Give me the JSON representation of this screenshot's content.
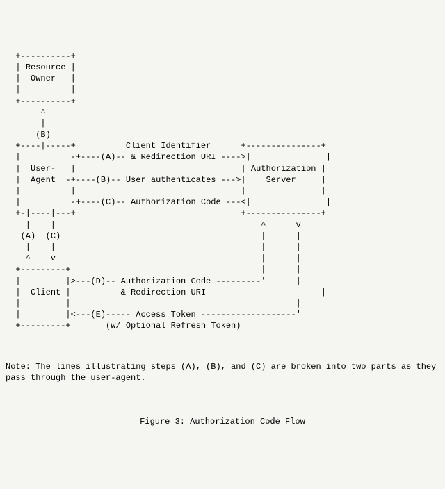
{
  "boxes": {
    "resource_owner_l1": "Resource",
    "resource_owner_l2": "Owner",
    "user_agent_l1": "User-",
    "user_agent_l2": "Agent",
    "authz_server_l1": "Authorization",
    "authz_server_l2": "Server",
    "client": "Client"
  },
  "labels": {
    "client_identifier": "Client Identifier",
    "a_flow": "& Redirection URI",
    "b_flow": "User authenticates",
    "c_flow": "Authorization Code",
    "d_flow_l1": "Authorization Code",
    "d_flow_l2": "& Redirection URI",
    "e_flow": "Access Token",
    "e_sub": "(w/ Optional Refresh Token)"
  },
  "steps": {
    "A": "(A)",
    "B": "(B)",
    "C": "(C)",
    "D": "(D)",
    "E": "(E)"
  },
  "note": "Note: The lines illustrating steps (A), (B), and (C) are broken into two parts as they pass through the user-agent.",
  "caption": "Figure 3: Authorization Code Flow"
}
